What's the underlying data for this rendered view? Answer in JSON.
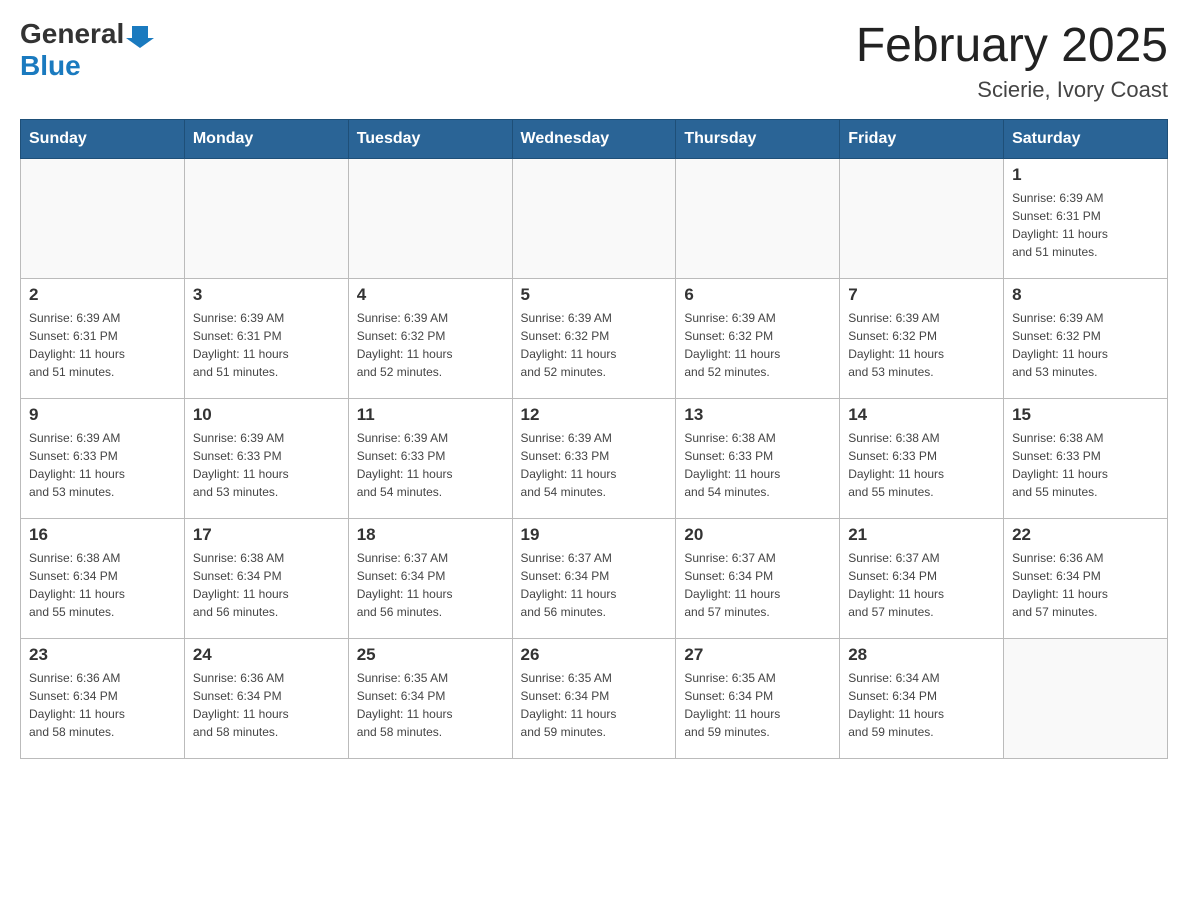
{
  "logo": {
    "general": "General",
    "blue": "Blue",
    "arrow_title": "GeneralBlue logo"
  },
  "title": "February 2025",
  "subtitle": "Scierie, Ivory Coast",
  "days_of_week": [
    "Sunday",
    "Monday",
    "Tuesday",
    "Wednesday",
    "Thursday",
    "Friday",
    "Saturday"
  ],
  "weeks": [
    [
      {
        "day": "",
        "info": ""
      },
      {
        "day": "",
        "info": ""
      },
      {
        "day": "",
        "info": ""
      },
      {
        "day": "",
        "info": ""
      },
      {
        "day": "",
        "info": ""
      },
      {
        "day": "",
        "info": ""
      },
      {
        "day": "1",
        "info": "Sunrise: 6:39 AM\nSunset: 6:31 PM\nDaylight: 11 hours\nand 51 minutes."
      }
    ],
    [
      {
        "day": "2",
        "info": "Sunrise: 6:39 AM\nSunset: 6:31 PM\nDaylight: 11 hours\nand 51 minutes."
      },
      {
        "day": "3",
        "info": "Sunrise: 6:39 AM\nSunset: 6:31 PM\nDaylight: 11 hours\nand 51 minutes."
      },
      {
        "day": "4",
        "info": "Sunrise: 6:39 AM\nSunset: 6:32 PM\nDaylight: 11 hours\nand 52 minutes."
      },
      {
        "day": "5",
        "info": "Sunrise: 6:39 AM\nSunset: 6:32 PM\nDaylight: 11 hours\nand 52 minutes."
      },
      {
        "day": "6",
        "info": "Sunrise: 6:39 AM\nSunset: 6:32 PM\nDaylight: 11 hours\nand 52 minutes."
      },
      {
        "day": "7",
        "info": "Sunrise: 6:39 AM\nSunset: 6:32 PM\nDaylight: 11 hours\nand 53 minutes."
      },
      {
        "day": "8",
        "info": "Sunrise: 6:39 AM\nSunset: 6:32 PM\nDaylight: 11 hours\nand 53 minutes."
      }
    ],
    [
      {
        "day": "9",
        "info": "Sunrise: 6:39 AM\nSunset: 6:33 PM\nDaylight: 11 hours\nand 53 minutes."
      },
      {
        "day": "10",
        "info": "Sunrise: 6:39 AM\nSunset: 6:33 PM\nDaylight: 11 hours\nand 53 minutes."
      },
      {
        "day": "11",
        "info": "Sunrise: 6:39 AM\nSunset: 6:33 PM\nDaylight: 11 hours\nand 54 minutes."
      },
      {
        "day": "12",
        "info": "Sunrise: 6:39 AM\nSunset: 6:33 PM\nDaylight: 11 hours\nand 54 minutes."
      },
      {
        "day": "13",
        "info": "Sunrise: 6:38 AM\nSunset: 6:33 PM\nDaylight: 11 hours\nand 54 minutes."
      },
      {
        "day": "14",
        "info": "Sunrise: 6:38 AM\nSunset: 6:33 PM\nDaylight: 11 hours\nand 55 minutes."
      },
      {
        "day": "15",
        "info": "Sunrise: 6:38 AM\nSunset: 6:33 PM\nDaylight: 11 hours\nand 55 minutes."
      }
    ],
    [
      {
        "day": "16",
        "info": "Sunrise: 6:38 AM\nSunset: 6:34 PM\nDaylight: 11 hours\nand 55 minutes."
      },
      {
        "day": "17",
        "info": "Sunrise: 6:38 AM\nSunset: 6:34 PM\nDaylight: 11 hours\nand 56 minutes."
      },
      {
        "day": "18",
        "info": "Sunrise: 6:37 AM\nSunset: 6:34 PM\nDaylight: 11 hours\nand 56 minutes."
      },
      {
        "day": "19",
        "info": "Sunrise: 6:37 AM\nSunset: 6:34 PM\nDaylight: 11 hours\nand 56 minutes."
      },
      {
        "day": "20",
        "info": "Sunrise: 6:37 AM\nSunset: 6:34 PM\nDaylight: 11 hours\nand 57 minutes."
      },
      {
        "day": "21",
        "info": "Sunrise: 6:37 AM\nSunset: 6:34 PM\nDaylight: 11 hours\nand 57 minutes."
      },
      {
        "day": "22",
        "info": "Sunrise: 6:36 AM\nSunset: 6:34 PM\nDaylight: 11 hours\nand 57 minutes."
      }
    ],
    [
      {
        "day": "23",
        "info": "Sunrise: 6:36 AM\nSunset: 6:34 PM\nDaylight: 11 hours\nand 58 minutes."
      },
      {
        "day": "24",
        "info": "Sunrise: 6:36 AM\nSunset: 6:34 PM\nDaylight: 11 hours\nand 58 minutes."
      },
      {
        "day": "25",
        "info": "Sunrise: 6:35 AM\nSunset: 6:34 PM\nDaylight: 11 hours\nand 58 minutes."
      },
      {
        "day": "26",
        "info": "Sunrise: 6:35 AM\nSunset: 6:34 PM\nDaylight: 11 hours\nand 59 minutes."
      },
      {
        "day": "27",
        "info": "Sunrise: 6:35 AM\nSunset: 6:34 PM\nDaylight: 11 hours\nand 59 minutes."
      },
      {
        "day": "28",
        "info": "Sunrise: 6:34 AM\nSunset: 6:34 PM\nDaylight: 11 hours\nand 59 minutes."
      },
      {
        "day": "",
        "info": ""
      }
    ]
  ]
}
